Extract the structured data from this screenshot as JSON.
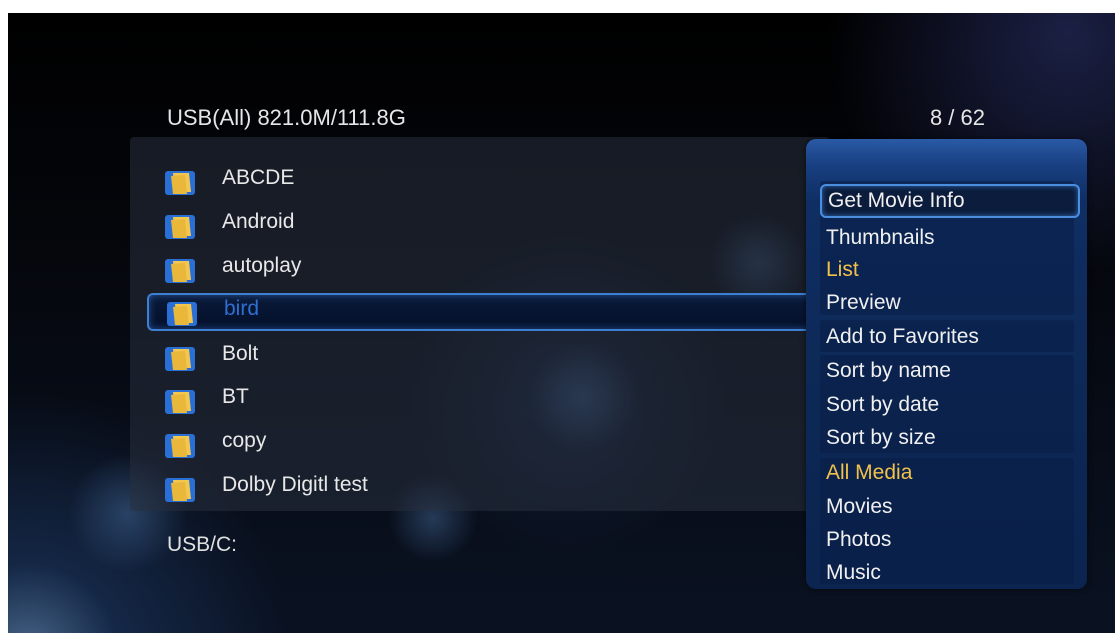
{
  "header": {
    "storage": "USB(All) 821.0M/111.8G",
    "position": "8 / 62"
  },
  "files": [
    {
      "name": "ABCDE",
      "icon": "folder-icon"
    },
    {
      "name": "Android",
      "icon": "folder-icon"
    },
    {
      "name": "autoplay",
      "icon": "folder-icon"
    },
    {
      "name": "bird",
      "icon": "folder-icon",
      "selected": true
    },
    {
      "name": "Bolt",
      "icon": "folder-icon"
    },
    {
      "name": "BT",
      "icon": "folder-icon"
    },
    {
      "name": "copy",
      "icon": "folder-icon"
    },
    {
      "name": "Dolby Digitl test",
      "icon": "folder-icon"
    }
  ],
  "path": "USB/C:",
  "menu": {
    "items": [
      {
        "label": "Get Movie Info",
        "state": "focused"
      },
      {
        "label": "Thumbnails"
      },
      {
        "label": "List",
        "state": "active"
      },
      {
        "label": "Preview"
      },
      {
        "label": "Add to Favorites"
      },
      {
        "label": "Sort by name"
      },
      {
        "label": "Sort by date"
      },
      {
        "label": "Sort by size"
      },
      {
        "label": "All Media",
        "state": "active"
      },
      {
        "label": "Movies"
      },
      {
        "label": "Photos"
      },
      {
        "label": "Music"
      }
    ]
  },
  "colors": {
    "active": "#f2c14a",
    "selection_border": "#3d7fd0",
    "selected_text": "#2e6fd0",
    "menu_bg": "#0c2855"
  }
}
